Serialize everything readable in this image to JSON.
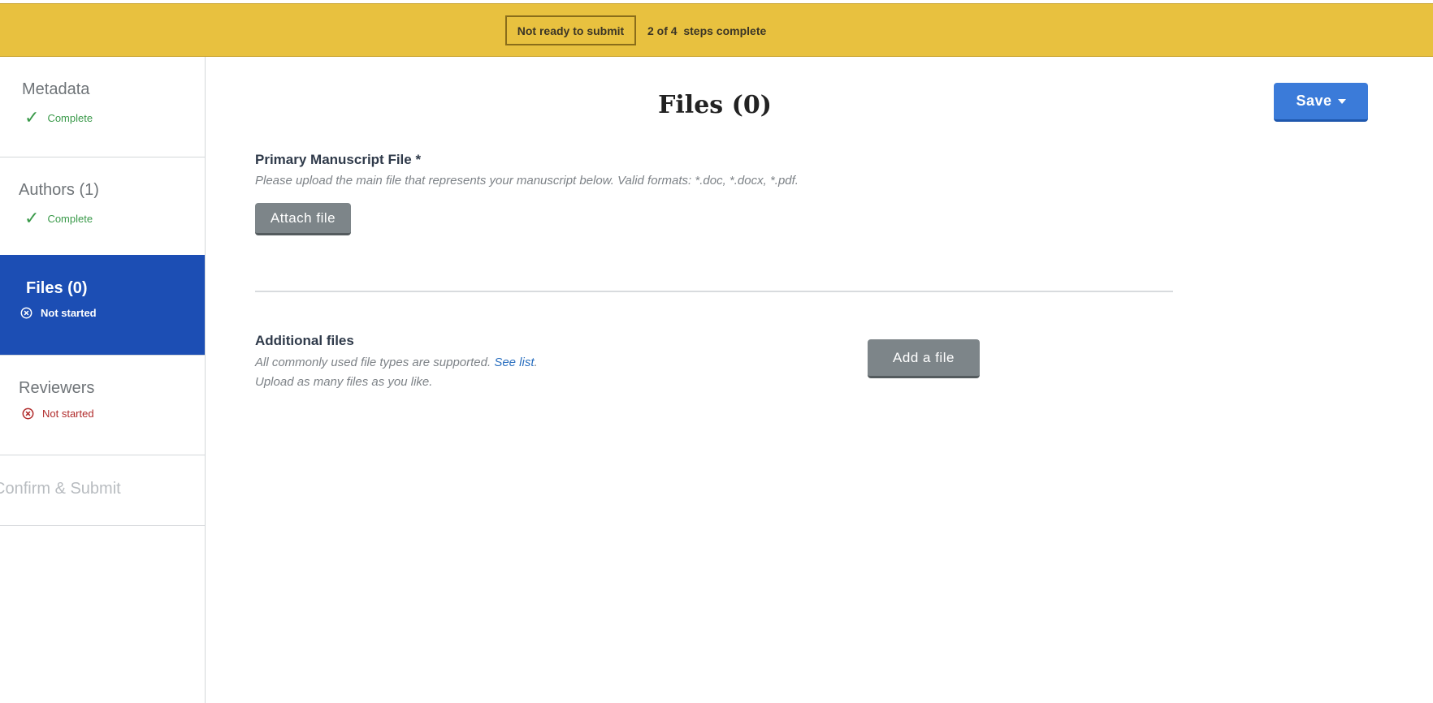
{
  "status_bar": {
    "badge": "Not ready to submit",
    "steps_text": "2 of 4  steps complete",
    "color": "#e8c13f"
  },
  "sidebar": {
    "items": [
      {
        "label": "Metadata",
        "status": "Complete",
        "status_icon": "checkmark-icon"
      },
      {
        "label": "Authors (1)",
        "status": "Complete",
        "status_icon": "checkmark-icon"
      },
      {
        "label": "Files (0)",
        "status": "Not started",
        "status_icon": "x-circle-icon",
        "active": true
      },
      {
        "label": "Reviewers",
        "status": "Not started",
        "status_icon": "x-circle-icon"
      },
      {
        "label": "Confirm & Submit",
        "disabled": true
      }
    ],
    "active_color": "#1c4eb4"
  },
  "main": {
    "title": "Files (0)",
    "save_label": "Save",
    "primary": {
      "heading": "Primary Manuscript File *",
      "help": "Please upload the main file that represents your manuscript below. Valid formats: *.doc, *.docx, *.pdf.",
      "button": "Attach file"
    },
    "additional": {
      "heading": "Additional files",
      "help_prefix": "All commonly used file types are supported. ",
      "help_link": "See list",
      "help_suffix": ".",
      "help_line2": "Upload as many files as you like.",
      "button": "Add a file"
    }
  },
  "colors": {
    "primary_button": "#3b7bd9",
    "gray_button": "#7d8589",
    "complete": "#3a9a4a",
    "not_started": "#b02a2a"
  }
}
